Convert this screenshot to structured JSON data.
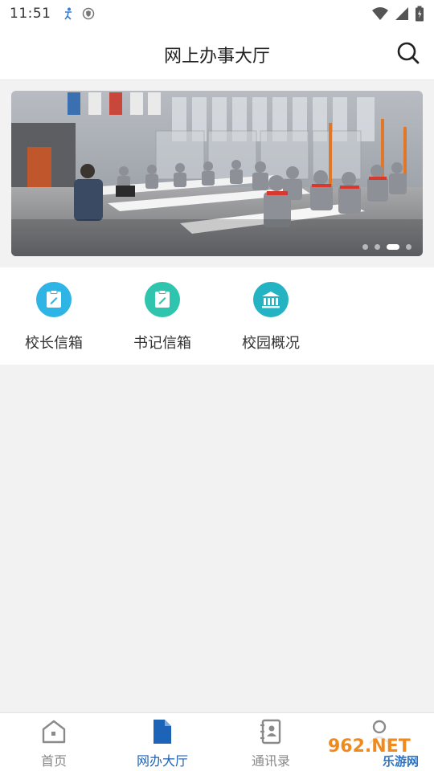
{
  "status": {
    "time": "11:51"
  },
  "header": {
    "title": "网上办事大厅"
  },
  "banner": {
    "slide_count": 4,
    "active_index": 2
  },
  "quick_menu": [
    {
      "label": "校长信箱",
      "icon": "mailbox-pen-icon",
      "color": "#2fb4e6"
    },
    {
      "label": "书记信箱",
      "icon": "mailbox-pen-icon",
      "color": "#2fc4ad"
    },
    {
      "label": "校园概况",
      "icon": "building-icon",
      "color": "#23b3c2"
    }
  ],
  "bottom_nav": [
    {
      "label": "首页",
      "icon": "home-icon",
      "active": false
    },
    {
      "label": "网办大厅",
      "icon": "document-icon",
      "active": true
    },
    {
      "label": "通讯录",
      "icon": "contacts-icon",
      "active": false
    },
    {
      "label": "",
      "icon": "profile-icon",
      "active": false
    }
  ],
  "watermark": {
    "text": "962.NET",
    "subtext": "乐游网"
  },
  "colors": {
    "accent": "#1d63b8",
    "inactive": "#888888"
  }
}
